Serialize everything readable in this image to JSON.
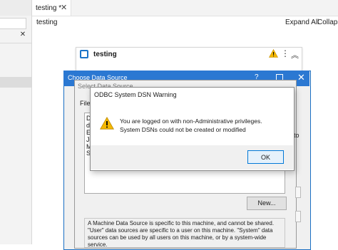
{
  "editor_tab": {
    "label": "testing *"
  },
  "toolbar": {
    "title": "testing",
    "expand_all": "Expand All",
    "collapse": "Collapse"
  },
  "card": {
    "title": "testing"
  },
  "choose_data_source": {
    "title": "Choose Data Source",
    "help": "?"
  },
  "select_data_source": {
    "title": "Select Data Source",
    "file_label": "File",
    "list_letters": [
      "D",
      "d",
      "E",
      "Je",
      "M",
      "S"
    ],
    "side_text": "to",
    "new_button": "New...",
    "info": "A Machine Data Source is specific to this machine, and cannot be shared. \"User\" data sources are specific to a user on this machine. \"System\" data sources can be used by all users on this machine, or by a system-wide service."
  },
  "odbc_warning": {
    "title": "ODBC System DSN Warning",
    "message": "You are logged on with non-Administrative privileges. System DSNs could not be created or modified",
    "ok_button": "OK"
  },
  "colors": {
    "accent": "#2b78d2",
    "warning": "#f5b800"
  }
}
